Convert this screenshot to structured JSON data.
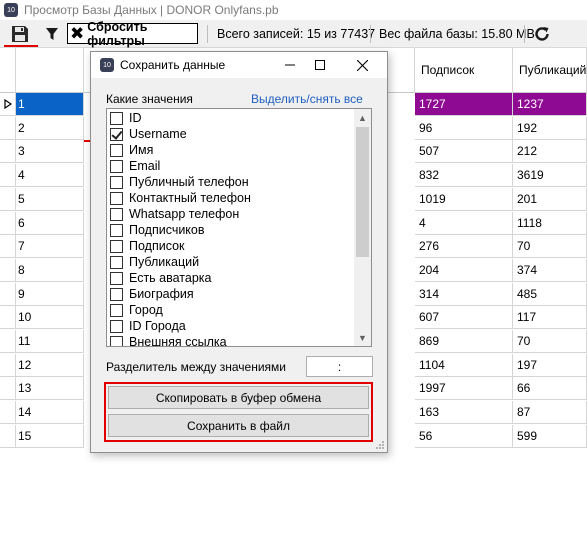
{
  "window": {
    "title": "Просмотр Базы Данных | DONOR Onlyfans.pb",
    "icon_text": "10"
  },
  "toolbar": {
    "save_icon": "floppy-disk-icon",
    "filter_icon": "funnel-icon",
    "reset_filters_label": "Сбросить фильтры",
    "total_records_text": "Всего записей: 15 из 77437",
    "file_size_text": "Вес файла базы: 15.80 MB",
    "refresh_icon": "refresh-icon"
  },
  "grid": {
    "columns": [
      "Подписок",
      "Публикаций"
    ],
    "rows": [
      {
        "id": "1",
        "subs": "1727",
        "pubs": "1237",
        "selected": true
      },
      {
        "id": "2",
        "subs": "96",
        "pubs": "192"
      },
      {
        "id": "3",
        "subs": "507",
        "pubs": "212"
      },
      {
        "id": "4",
        "subs": "832",
        "pubs": "3619"
      },
      {
        "id": "5",
        "subs": "1019",
        "pubs": "201"
      },
      {
        "id": "6",
        "subs": "4",
        "pubs": "1118"
      },
      {
        "id": "7",
        "subs": "276",
        "pubs": "70"
      },
      {
        "id": "8",
        "subs": "204",
        "pubs": "374"
      },
      {
        "id": "9",
        "subs": "314",
        "pubs": "485"
      },
      {
        "id": "10",
        "subs": "607",
        "pubs": "117"
      },
      {
        "id": "11",
        "subs": "869",
        "pubs": "70"
      },
      {
        "id": "12",
        "subs": "1104",
        "pubs": "197"
      },
      {
        "id": "13",
        "subs": "1997",
        "pubs": "66"
      },
      {
        "id": "14",
        "subs": "163",
        "pubs": "87"
      },
      {
        "id": "15",
        "subs": "56",
        "pubs": "599"
      }
    ]
  },
  "dialog": {
    "title": "Сохранить данные",
    "icon_text": "10",
    "which_values_label": "Какие значения",
    "select_toggle_link": "Выделить/снять все",
    "items": [
      {
        "label": "ID",
        "checked": false
      },
      {
        "label": "Username",
        "checked": true
      },
      {
        "label": "Имя",
        "checked": false
      },
      {
        "label": "Email",
        "checked": false
      },
      {
        "label": "Публичный телефон",
        "checked": false
      },
      {
        "label": "Контактный телефон",
        "checked": false
      },
      {
        "label": "Whatsapp телефон",
        "checked": false
      },
      {
        "label": "Подписчиков",
        "checked": false
      },
      {
        "label": "Подписок",
        "checked": false
      },
      {
        "label": "Публикаций",
        "checked": false
      },
      {
        "label": "Есть аватарка",
        "checked": false
      },
      {
        "label": "Биография",
        "checked": false
      },
      {
        "label": "Город",
        "checked": false
      },
      {
        "label": "ID Города",
        "checked": false
      },
      {
        "label": "Внешняя ссылка",
        "checked": false
      }
    ],
    "separator_label": "Разделитель между значениями",
    "separator_value": ":",
    "copy_button": "Скопировать в буфер обмена",
    "save_button": "Сохранить в файл"
  },
  "colors": {
    "selected_row": "#8f0a93",
    "selected_id": "#0a64c8",
    "annotation_red": "#e00000",
    "link": "#1f5fbf"
  }
}
